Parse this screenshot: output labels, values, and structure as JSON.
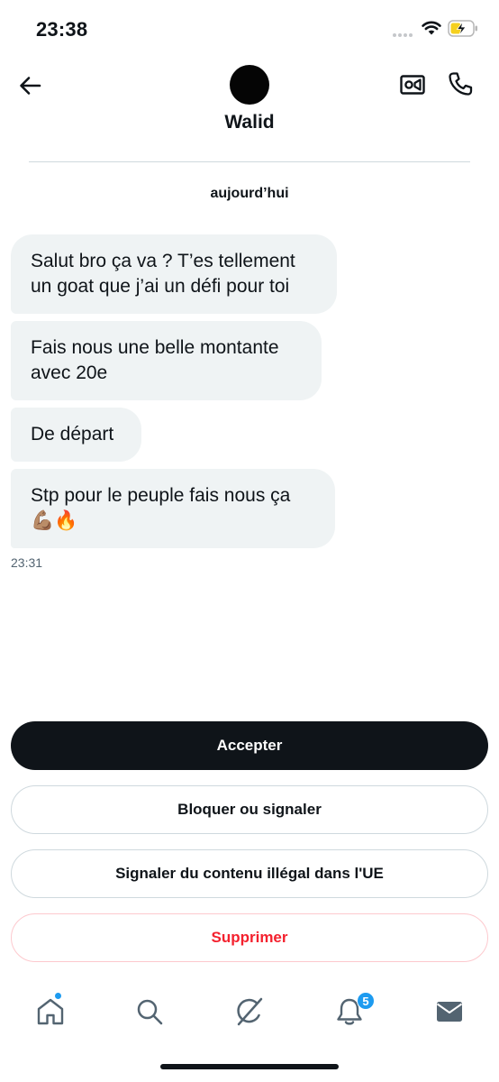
{
  "status_bar": {
    "time": "23:38",
    "icons": [
      "signal-dots-icon",
      "wifi-icon",
      "battery-charging-icon"
    ],
    "battery_color": "#f5d01e"
  },
  "header": {
    "contact_name": "Walid",
    "icons": [
      "back-arrow-icon",
      "video-camera-icon",
      "phone-icon"
    ]
  },
  "conversation": {
    "date_label": "aujourd’hui",
    "messages": [
      {
        "text": "Salut bro ça va ? T’es tellement\nun goat que j’ai un défi pour toi"
      },
      {
        "text": "Fais nous une belle montante\navec 20e"
      },
      {
        "text": "De départ"
      },
      {
        "text": "Stp pour le peuple fais nous ça\n💪🏽🔥"
      }
    ],
    "last_time": "23:31"
  },
  "actions": {
    "accept": "Accepter",
    "block": "Bloquer ou signaler",
    "report": "Signaler du contenu illégal dans l'UE",
    "delete": "Supprimer"
  },
  "nav": {
    "items": [
      "home-icon",
      "search-icon",
      "grok-icon",
      "notifications-icon",
      "messages-icon"
    ],
    "notif_badge": "5",
    "accent": "#1d9bf0"
  }
}
